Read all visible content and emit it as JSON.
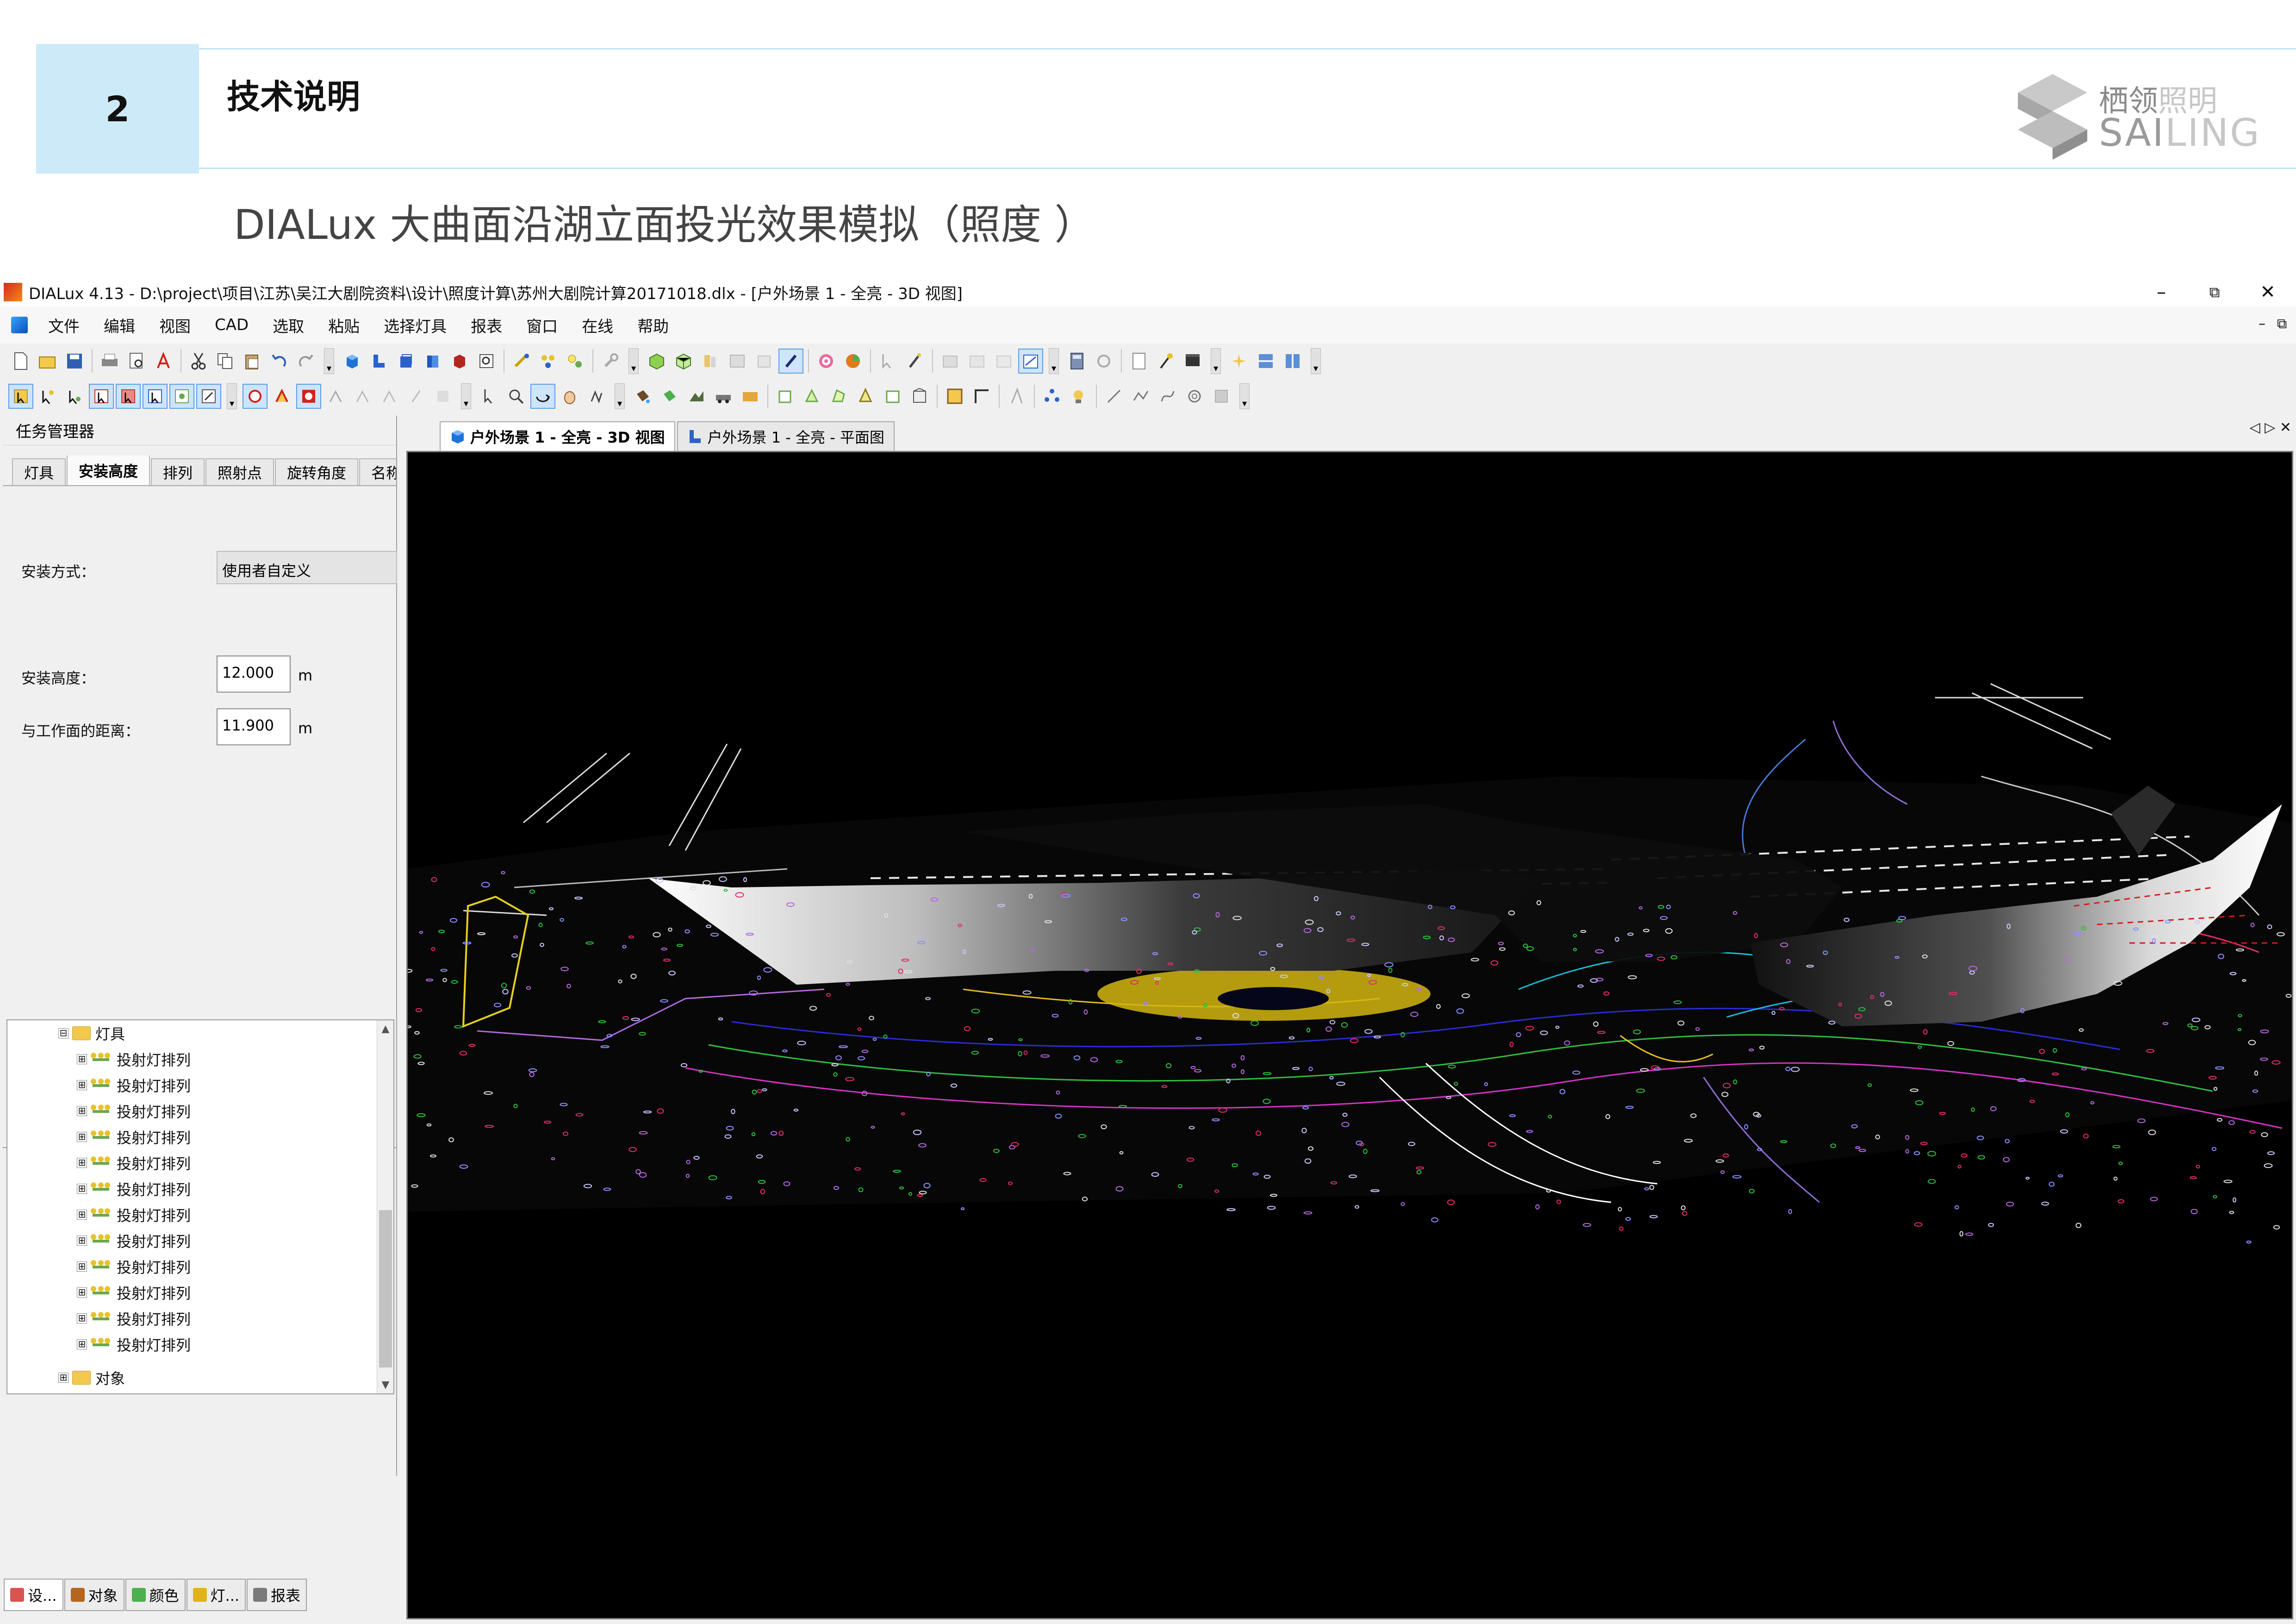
{
  "slide": {
    "section_number": "2",
    "section_title": "技术说明",
    "subtitle": "DIALux 大曲面沿湖立面投光效果模拟（照度 ）",
    "logo": {
      "cn_bold": "栖领",
      "cn_light": "照明",
      "en_bold": "SAI",
      "en_light": "LING"
    }
  },
  "window": {
    "title": "DIALux 4.13 - D:\\project\\项目\\江苏\\吴江大剧院资料\\设计\\照度计算\\苏州大剧院计算20171018.dlx - [户外场景 1 - 全亮 - 3D 视图]",
    "controls": {
      "minimize": "–",
      "restore": "⧉",
      "close": "✕"
    }
  },
  "menu": [
    "文件",
    "编辑",
    "视图",
    "CAD",
    "选取",
    "粘贴",
    "选择灯具",
    "报表",
    "窗口",
    "在线",
    "帮助"
  ],
  "task_manager": {
    "title": "任务管理器",
    "tabs": [
      "灯具",
      "安装高度",
      "排列",
      "照射点",
      "旋转角度",
      "名称"
    ],
    "active_tab": "安装高度",
    "mount_type_label": "安装方式：",
    "mount_type_value": "使用者自定义",
    "mount_height_label": "安装高度：",
    "mount_height_value": "12.000",
    "mount_height_unit": "m",
    "workplane_distance_label": "与工作面的距离：",
    "workplane_distance_value": "11.900",
    "workplane_distance_unit": "m"
  },
  "tree": {
    "folder_luminaires": "灯具",
    "items": [
      "投射灯排列",
      "投射灯排列",
      "投射灯排列",
      "投射灯排列",
      "投射灯排列",
      "投射灯排列",
      "投射灯排列",
      "投射灯排列",
      "投射灯排列",
      "投射灯排列",
      "投射灯排列",
      "投射灯排列"
    ],
    "folder_objects": "对象"
  },
  "bottom_tabs": [
    {
      "label": "设...",
      "color": "#d9534f"
    },
    {
      "label": "对象",
      "color": "#b5651d"
    },
    {
      "label": "颜色",
      "color": "#4caf50"
    },
    {
      "label": "灯...",
      "color": "#e0b21c"
    },
    {
      "label": "报表",
      "color": "#7a7a7a"
    }
  ],
  "doc_tabs": [
    {
      "label": "户外场景 1 - 全亮 - 3D 视图",
      "active": true,
      "icon_color": "#1e73d8"
    },
    {
      "label": "户外场景 1 - 全亮 - 平面图",
      "active": false,
      "icon_color": "#2a62c9"
    }
  ],
  "icons": {
    "tree_expand": "⊟",
    "tree_collapsed": "⊞",
    "scroll_up": "▲",
    "scroll_down": "▼",
    "tab_prev": "◁",
    "tab_next": "▷",
    "tab_close": "✕",
    "mdi_min": "–",
    "mdi_restore": "⧉"
  }
}
